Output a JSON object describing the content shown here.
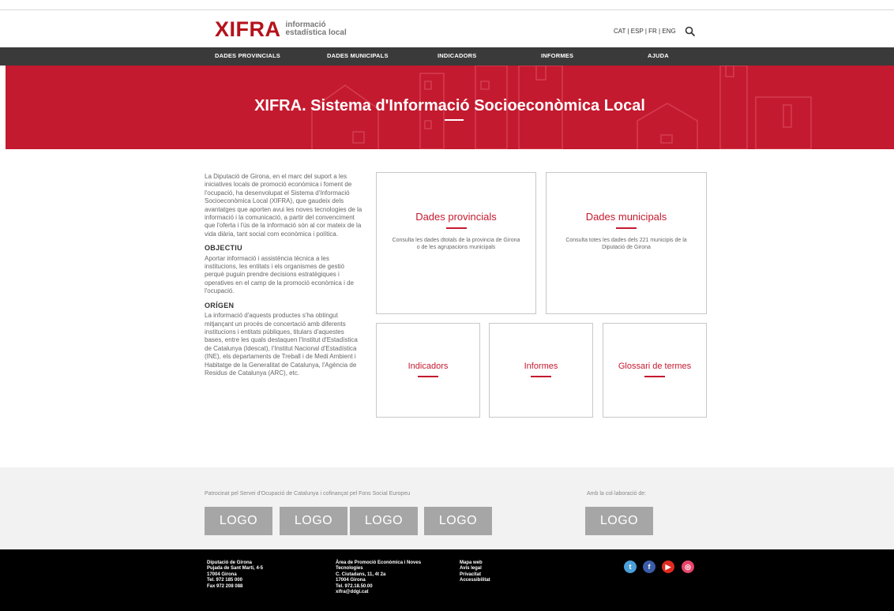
{
  "header": {
    "logo_main": "XIFRA",
    "logo_sub_1": "informació",
    "logo_sub_2": "estadística local",
    "languages": "CAT | ESP | FR | ENG",
    "search_icon": "search-icon"
  },
  "nav": {
    "items": [
      "DADES PROVINCIALS",
      "DADES MUNICIPALS",
      "INDICADORS",
      "INFORMES",
      "AJUDA"
    ]
  },
  "hero": {
    "title": "XIFRA. Sistema d'Informació Socioeconòmica Local"
  },
  "intro": {
    "paragraph": "La Diputació de Girona, en el marc del suport a les iniciatives locals de promoció econòmica i foment de l'ocupació, ha desenvolupat el Sistema d'Informació Socioeconòmica Local (XIFRA), que gaudeix dels avantatges que aporten avui les noves tecnologies de la informació i la comunicació, a partir del convenciment que l'oferta i l'ús de la informació són al cor mateix de la vida diària, tant social com econòmica i política.",
    "objectiu_title": "OBJECTIU",
    "objectiu_text": "Aportar informació i assistència tècnica a les institucions, les entitats i els organismes de gestió perquè puguin prendre decisions estratègiques i operatives en el camp de la promoció econòmica i de l'ocupació.",
    "origen_title": "ORÍGEN",
    "origen_text": "La informació d'aquests productes s'ha obtingut mitjançant un procés de concertació amb diferents institucions i entitats públiques, titulars d'aquestes bases, entre les quals destaquen l'Institut d'Estadística de Catalunya (Idescat), l'Institut Nacional d'Estadística (INE), els departaments de Treball i de Medi Ambient i Habitatge de la Generalitat de Catalunya, l'Agència de Residus de Catalunya (ARC), etc."
  },
  "cards": {
    "provincials": {
      "title": "Dades provincials",
      "desc": "Consulta les dades dtotals de la provincia de Girona o de les agrupacions municipals"
    },
    "municipals": {
      "title": "Dades municipals",
      "desc": "Consulta totes les dades dels 221 municipis de la Diputació de Girona"
    },
    "indicadors": {
      "title": "Indicadors"
    },
    "informes": {
      "title": "Informes"
    },
    "glossari": {
      "title": "Glossari de termes"
    }
  },
  "sponsors": {
    "left_text": "Patrocinat pel Servei d'Ocupació de Catalunya i cofinançat pel Fons Social Europeu",
    "right_text": "Amb la col·laboració de:",
    "logo_label": "LOGO"
  },
  "footer": {
    "col1": [
      "Diputació de Girona",
      "Pujada de Sant Martí, 4-5",
      "17004 Girona",
      "Tel. 972 185 000",
      "Fax 972 208 088"
    ],
    "col2": [
      "Àrea de Promoció Econòmica i Noves",
      "Tecnologies",
      "C. Ciutadans, 11, 4t 2a",
      "17004 Girona",
      "Tel. 972.18.50.00",
      "xifra@ddgi.cat"
    ],
    "col3": [
      "Mapa web",
      "Avís legal",
      "Privacitat",
      "Accessibilitat"
    ],
    "social": [
      {
        "name": "twitter-icon",
        "color": "#4a9fd8",
        "glyph": "t"
      },
      {
        "name": "facebook-icon",
        "color": "#3b5ca8",
        "glyph": "f"
      },
      {
        "name": "youtube-icon",
        "color": "#e02a20",
        "glyph": "▶"
      },
      {
        "name": "instagram-icon",
        "color": "#e9446a",
        "glyph": "◎"
      }
    ]
  },
  "colors": {
    "brand_red": "#c41a2f",
    "nav_bg": "#3a3a3a",
    "footer_bg": "#000000"
  }
}
